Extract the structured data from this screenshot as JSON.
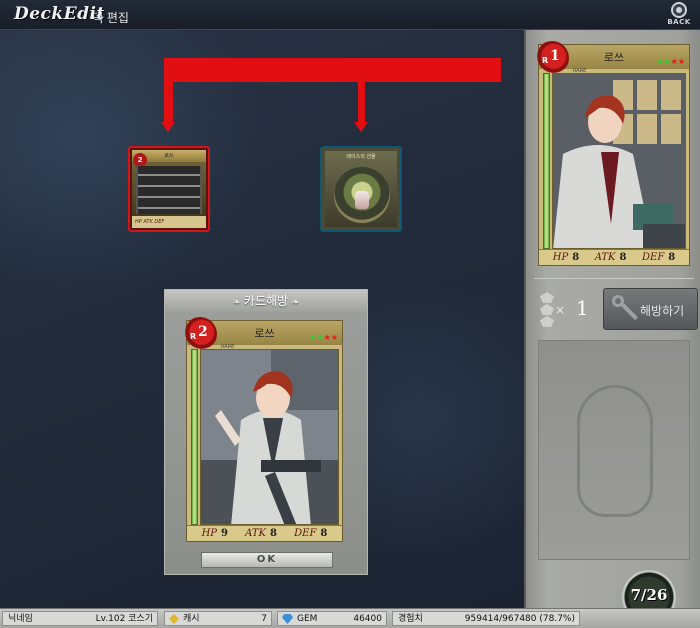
{
  "header": {
    "logo": "DeckEdit",
    "title": "덱 편집",
    "back_label": "BACK"
  },
  "material_card": {
    "rank": "2",
    "name": "로쓰",
    "stats_label": "HP  ATK  DEF"
  },
  "item_card": {
    "name": "레이스의 선물"
  },
  "release_panel": {
    "title": "카드해방",
    "ok_label": "OK"
  },
  "main_card": {
    "rank_letter": "R",
    "rank": "2",
    "name": "로쓰",
    "sub": "RARE",
    "stats": {
      "hp_label": "HP",
      "hp": "9",
      "atk_label": "ATK",
      "atk": "8",
      "def_label": "DEF",
      "def": "8"
    },
    "stars_green": 2,
    "stars_red": 2
  },
  "selected_card": {
    "rank_letter": "R",
    "rank": "1",
    "name": "로쓰",
    "sub": "RARE",
    "stats": {
      "hp_label": "HP",
      "hp": "8",
      "atk_label": "ATK",
      "atk": "8",
      "def_label": "DEF",
      "def": "8"
    },
    "stars_green": 2,
    "stars_red": 2
  },
  "release_material": {
    "multiplier": "×",
    "count": "1",
    "button_label": "해방하기"
  },
  "level_emblem": {
    "text": "7/26"
  },
  "status_bar": {
    "nickname_label": "닉네임",
    "level_value": "Lv.102 코스기",
    "cash_label": "캐시",
    "cash_value": "7",
    "gem_label": "GEM",
    "gem_value": "46400",
    "exp_label": "경험치",
    "exp_value": "959414/967480 (78.7%)"
  },
  "colors": {
    "connector": "#e20f12",
    "background": "#1d2634",
    "panel": "#a0a19d"
  }
}
